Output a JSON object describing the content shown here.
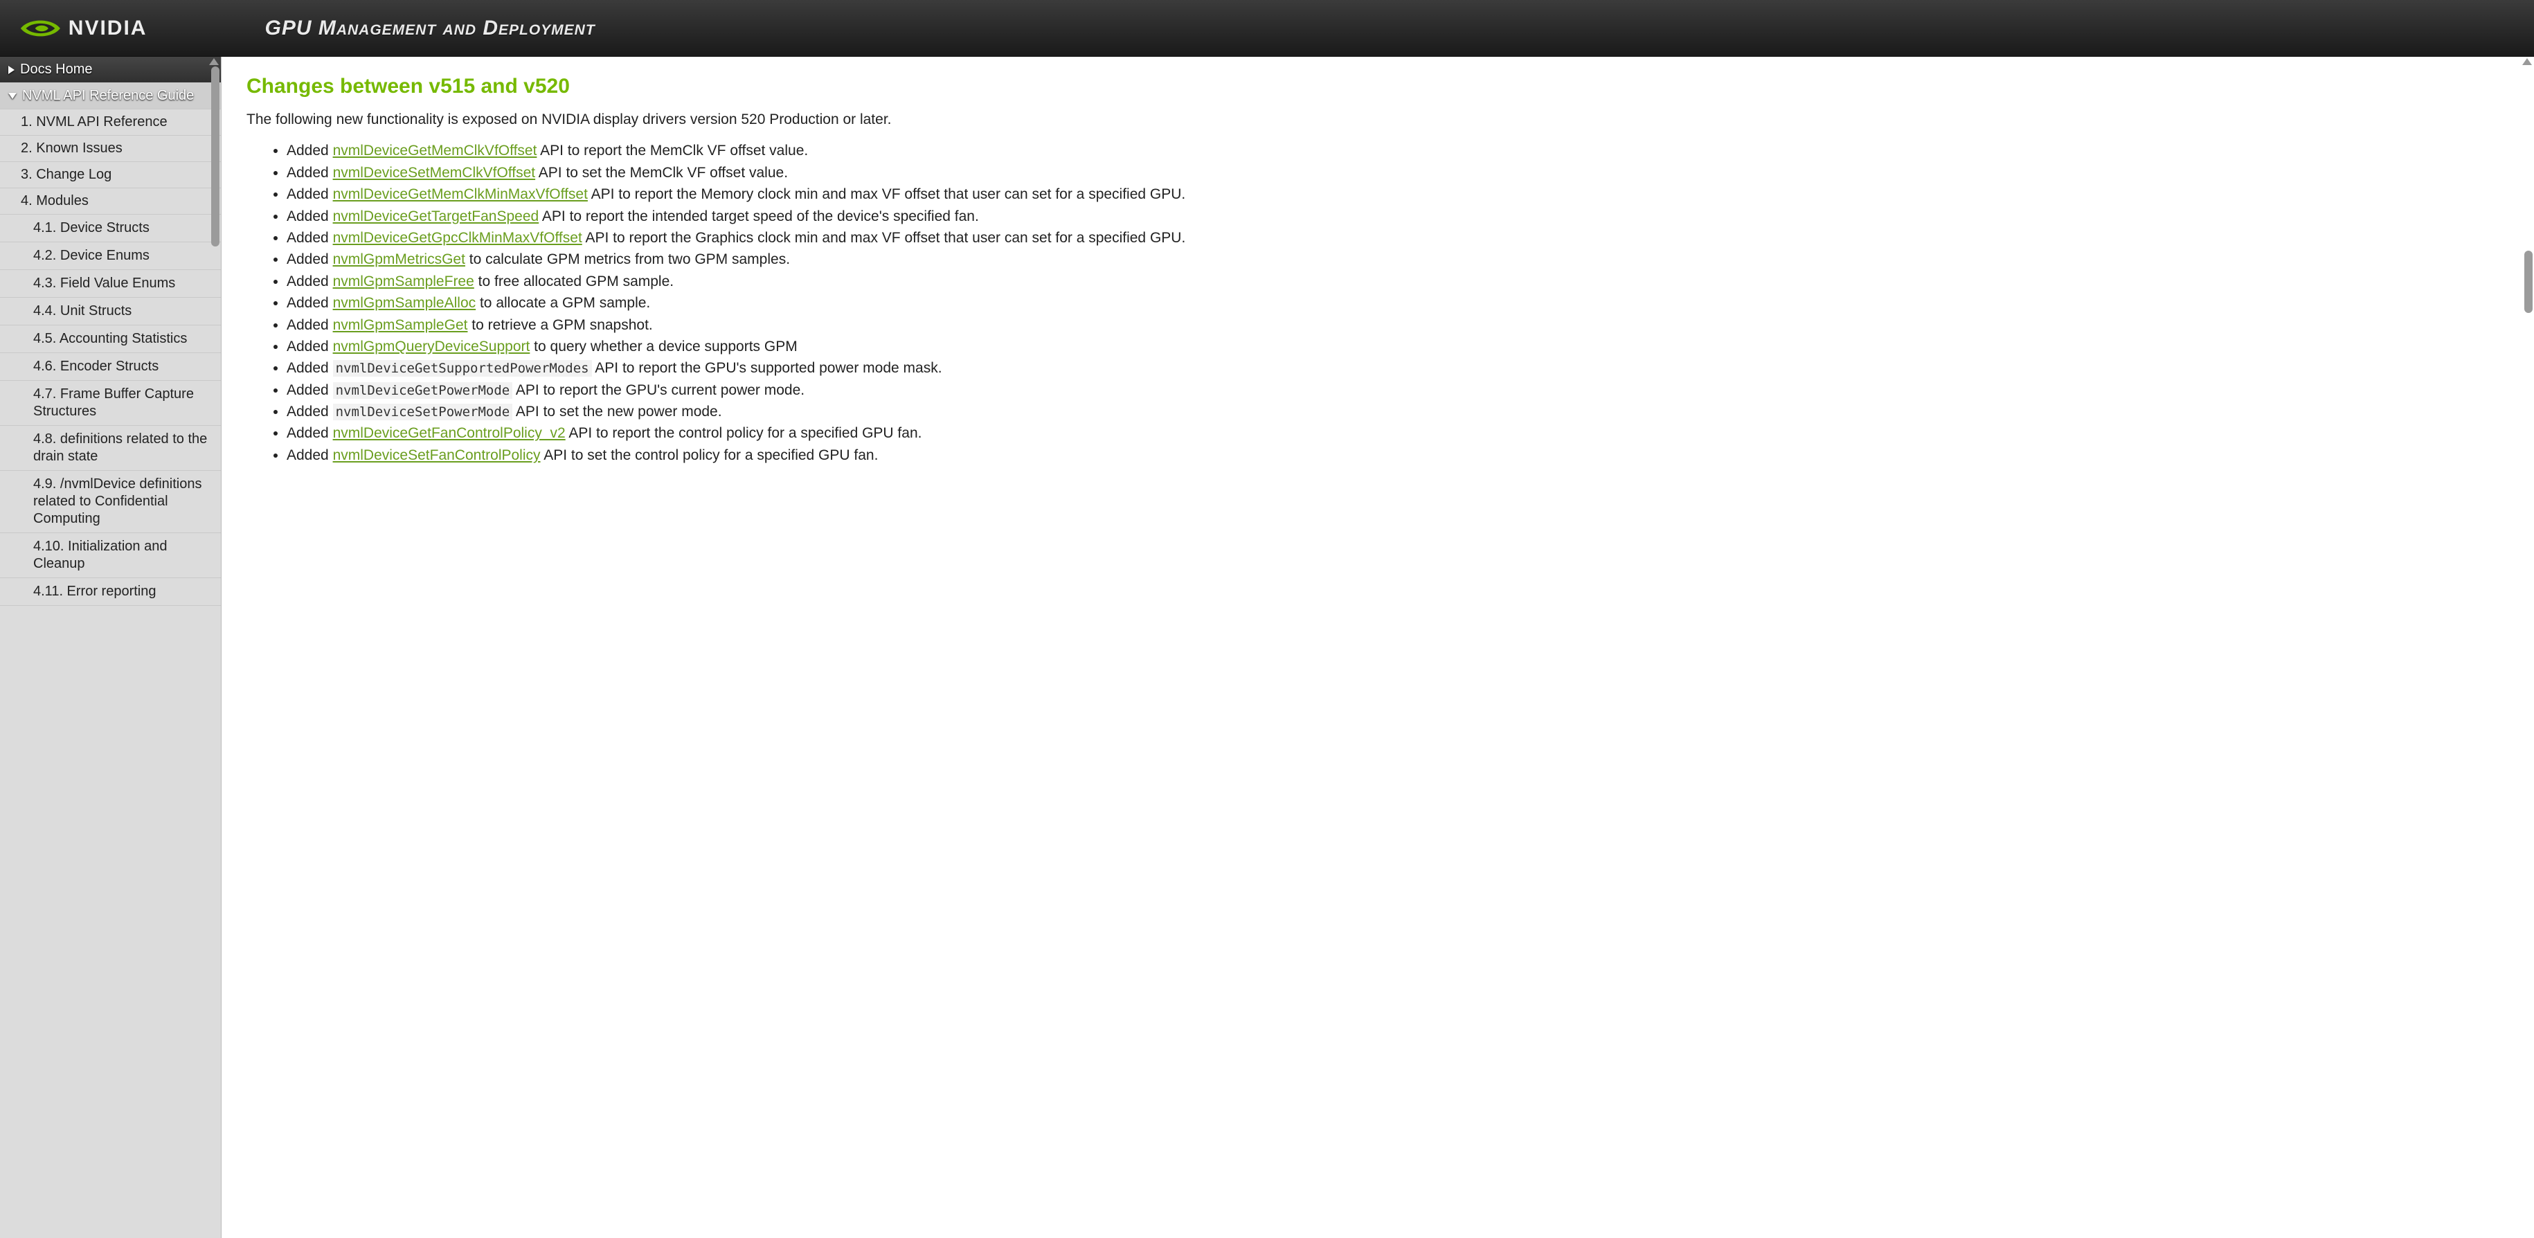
{
  "header": {
    "brand": "NVIDIA",
    "title": "GPU Management and Deployment"
  },
  "sidebar": {
    "top": [
      {
        "label": "Docs Home",
        "expanded": false
      },
      {
        "label": "NVML API Reference Guide",
        "expanded": true,
        "current": true
      }
    ],
    "items": [
      {
        "label": "1. NVML API Reference",
        "level": 1
      },
      {
        "label": "2. Known Issues",
        "level": 1
      },
      {
        "label": "3. Change Log",
        "level": 1
      },
      {
        "label": "4. Modules",
        "level": 1
      },
      {
        "label": "4.1. Device Structs",
        "level": 2
      },
      {
        "label": "4.2. Device Enums",
        "level": 2
      },
      {
        "label": "4.3. Field Value Enums",
        "level": 2
      },
      {
        "label": "4.4. Unit Structs",
        "level": 2
      },
      {
        "label": "4.5. Accounting Statistics",
        "level": 2
      },
      {
        "label": "4.6. Encoder Structs",
        "level": 2
      },
      {
        "label": "4.7. Frame Buffer Capture Structures",
        "level": 2
      },
      {
        "label": "4.8. definitions related to the drain state",
        "level": 2
      },
      {
        "label": "4.9. /nvmlDevice definitions related to Confidential Computing",
        "level": 2
      },
      {
        "label": "4.10. Initialization and Cleanup",
        "level": 2
      },
      {
        "label": "4.11. Error reporting",
        "level": 2
      }
    ]
  },
  "content": {
    "title": "Changes between v515 and v520",
    "intro": "The following new functionality is exposed on NVIDIA display drivers version 520 Production or later.",
    "changes": [
      {
        "prefix": "Added ",
        "api": "nvmlDeviceGetMemClkVfOffset",
        "kind": "link",
        "suffix": " API to report the MemClk VF offset value."
      },
      {
        "prefix": "Added ",
        "api": "nvmlDeviceSetMemClkVfOffset",
        "kind": "link",
        "suffix": " API to set the MemClk VF offset value."
      },
      {
        "prefix": "Added ",
        "api": "nvmlDeviceGetMemClkMinMaxVfOffset",
        "kind": "link",
        "suffix": " API to report the Memory clock min and max VF offset that user can set for a specified GPU."
      },
      {
        "prefix": "Added ",
        "api": "nvmlDeviceGetTargetFanSpeed",
        "kind": "link",
        "suffix": " API to report the intended target speed of the device's specified fan."
      },
      {
        "prefix": "Added ",
        "api": "nvmlDeviceGetGpcClkMinMaxVfOffset",
        "kind": "link",
        "suffix": " API to report the Graphics clock min and max VF offset that user can set for a specified GPU."
      },
      {
        "prefix": "Added ",
        "api": "nvmlGpmMetricsGet",
        "kind": "link",
        "suffix": " to calculate GPM metrics from two GPM samples."
      },
      {
        "prefix": "Added ",
        "api": "nvmlGpmSampleFree",
        "kind": "link",
        "suffix": " to free allocated GPM sample."
      },
      {
        "prefix": "Added ",
        "api": "nvmlGpmSampleAlloc",
        "kind": "link",
        "suffix": " to allocate a GPM sample."
      },
      {
        "prefix": "Added ",
        "api": "nvmlGpmSampleGet",
        "kind": "link",
        "suffix": " to retrieve a GPM snapshot."
      },
      {
        "prefix": "Added ",
        "api": "nvmlGpmQueryDeviceSupport",
        "kind": "link",
        "suffix": " to query whether a device supports GPM"
      },
      {
        "prefix": "Added ",
        "api": "nvmlDeviceGetSupportedPowerModes",
        "kind": "code",
        "suffix": " API to report the GPU's supported power mode mask."
      },
      {
        "prefix": "Added ",
        "api": "nvmlDeviceGetPowerMode",
        "kind": "code",
        "suffix": " API to report the GPU's current power mode."
      },
      {
        "prefix": "Added ",
        "api": "nvmlDeviceSetPowerMode",
        "kind": "code",
        "suffix": " API to set the new power mode."
      },
      {
        "prefix": "Added ",
        "api": "nvmlDeviceGetFanControlPolicy_v2",
        "kind": "link",
        "suffix": " API to report the control policy for a specified GPU fan."
      },
      {
        "prefix": "Added ",
        "api": "nvmlDeviceSetFanControlPolicy",
        "kind": "link",
        "suffix": " API to set the control policy for a specified GPU fan."
      }
    ]
  }
}
